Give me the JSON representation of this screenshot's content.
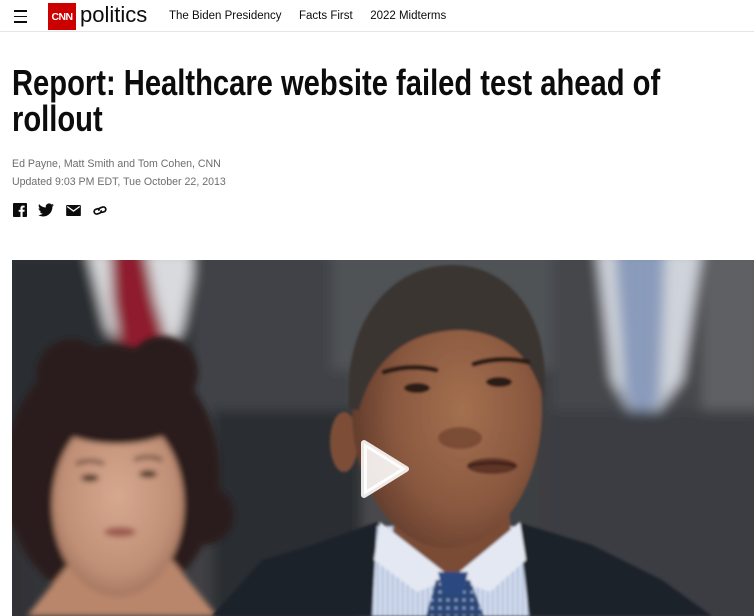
{
  "nav": {
    "menu_icon": "hamburger-icon",
    "logo_text": "CNN",
    "section": "politics",
    "links": [
      "The Biden Presidency",
      "Facts First",
      "2022 Midterms"
    ]
  },
  "article": {
    "headline": "Report: Healthcare website failed test ahead of rollout",
    "byline": "Ed Payne, Matt Smith and Tom Cohen, CNN",
    "updated": "Updated 9:03 PM EDT, Tue October 22, 2013",
    "share_icons": [
      "facebook-icon",
      "twitter-icon",
      "email-icon",
      "link-icon"
    ]
  },
  "video": {
    "play_icon": "play-icon"
  },
  "colors": {
    "brand_red": "#cc0000",
    "text": "#0c0c0c",
    "meta_gray": "#6e6e6e",
    "divider": "#e6e6e6"
  }
}
